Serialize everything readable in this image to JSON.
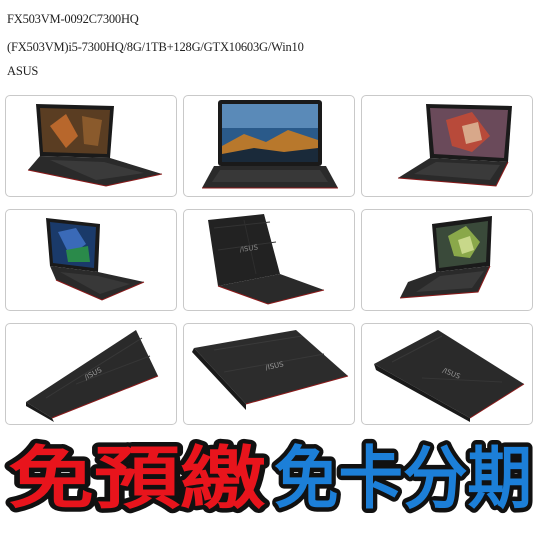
{
  "product": {
    "model_code": "FX503VM-0092C7300HQ",
    "spec_line": "(FX503VM)i5-7300HQ/8G/1TB+128G/GTX10603G/Win10",
    "brand": "ASUS"
  },
  "gallery": {
    "images": [
      {
        "view": "front-left-open",
        "screen": "game"
      },
      {
        "view": "front-open",
        "screen": "wallpaper"
      },
      {
        "view": "front-right-open",
        "screen": "game-dragon"
      },
      {
        "view": "side-left-open",
        "screen": "game-blue"
      },
      {
        "view": "lid-back-open",
        "screen": "none"
      },
      {
        "view": "side-right-open",
        "screen": "game-green"
      },
      {
        "view": "closed-left",
        "screen": "none"
      },
      {
        "view": "closed-front",
        "screen": "none"
      },
      {
        "view": "closed-right",
        "screen": "none"
      }
    ]
  },
  "banner": {
    "left_text": "免預繳",
    "right_text": "免卡分期",
    "left_color": "#e8141c",
    "right_color": "#1c7fd8"
  }
}
